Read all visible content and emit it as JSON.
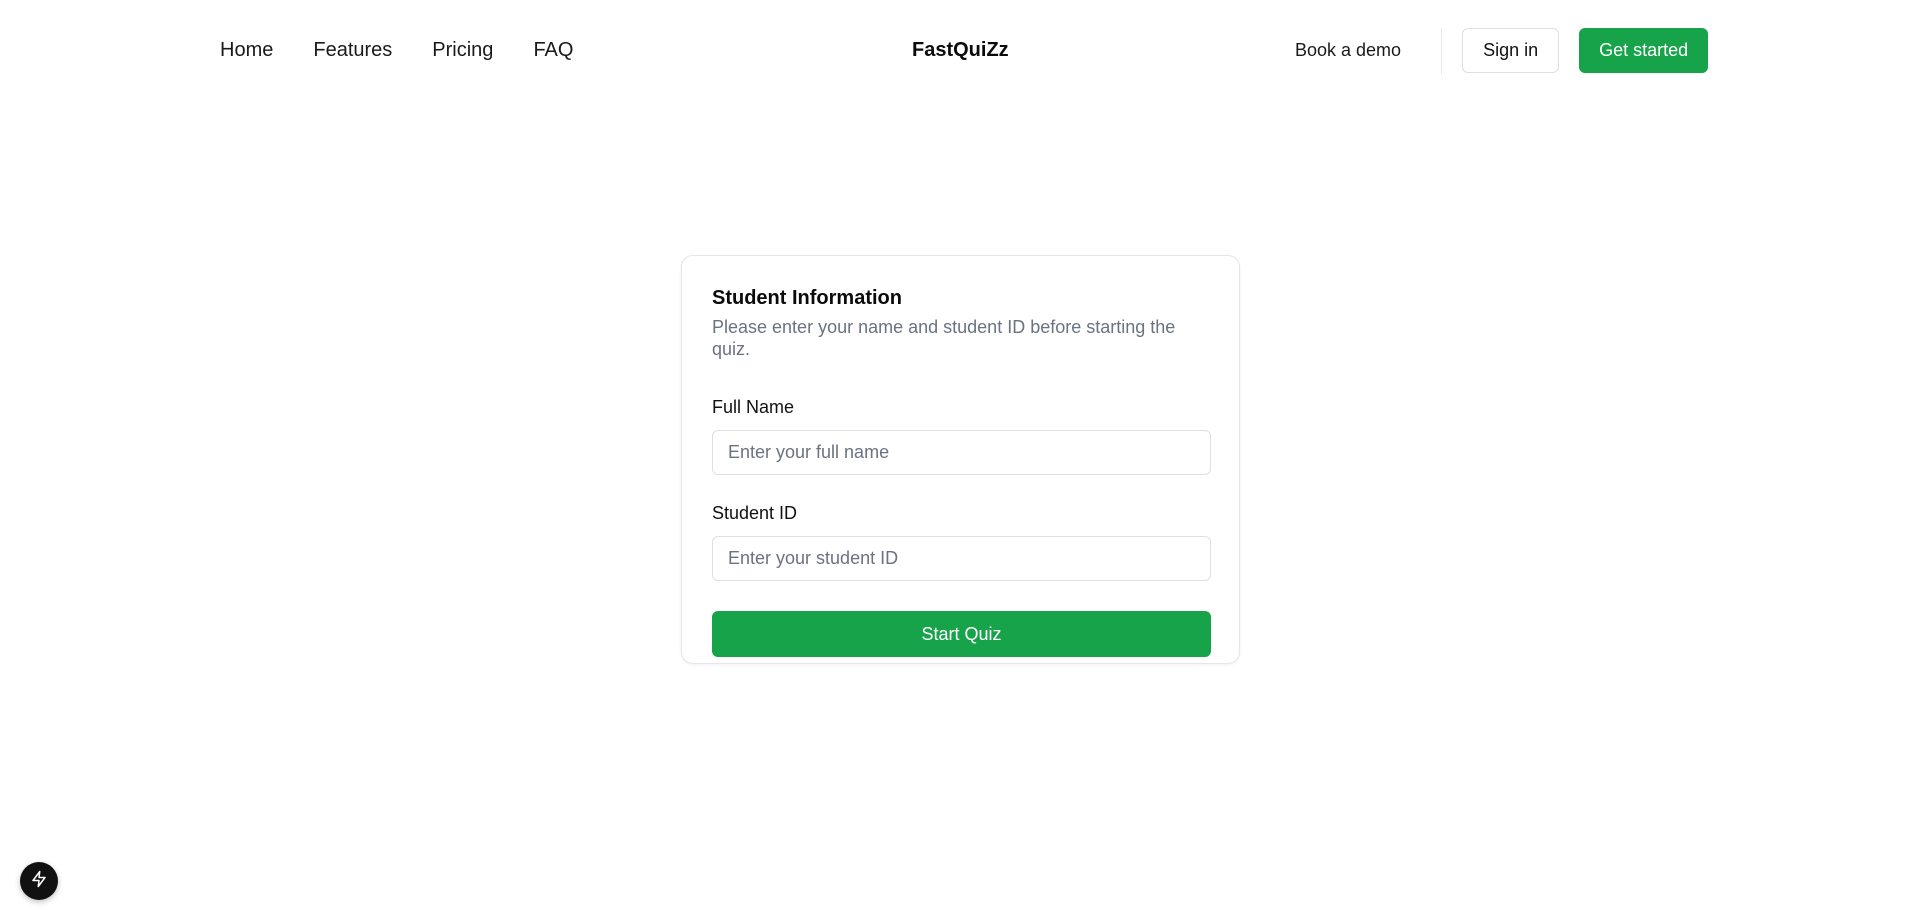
{
  "nav": {
    "links": [
      "Home",
      "Features",
      "Pricing",
      "FAQ"
    ],
    "brand": "FastQuiZz",
    "book_demo": "Book a demo",
    "sign_in": "Sign in",
    "get_started": "Get started"
  },
  "form": {
    "title": "Student Information",
    "subtitle": "Please enter your name and student ID before starting the quiz.",
    "full_name_label": "Full Name",
    "full_name_placeholder": "Enter your full name",
    "full_name_value": "",
    "student_id_label": "Student ID",
    "student_id_placeholder": "Enter your student ID",
    "student_id_value": "",
    "submit_label": "Start Quiz"
  },
  "fab": {
    "icon": "lightning-icon"
  },
  "colors": {
    "accent": "#16a34a",
    "muted_text": "#6b7280",
    "border": "#dcdfe3"
  }
}
